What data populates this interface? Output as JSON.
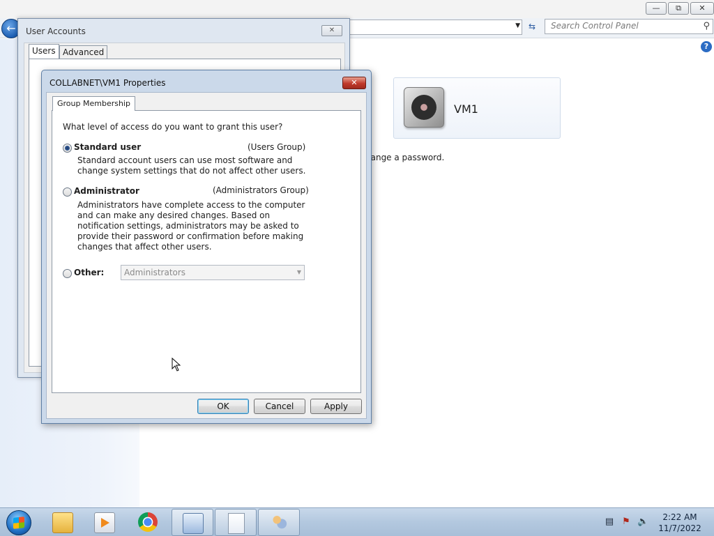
{
  "control_panel": {
    "search_placeholder": "Search Control Panel",
    "user_name": "VM1",
    "partial_text": "hange a password."
  },
  "user_accounts": {
    "title": "User Accounts",
    "tabs": [
      "Users",
      "Advanced"
    ]
  },
  "dialog": {
    "title": "COLLABNET\\VM1 Properties",
    "tab": "Group Membership",
    "question": "What level of access do you want to grant this user?",
    "options": [
      {
        "label": "Standard user",
        "group": "(Users Group)",
        "checked": true,
        "description": "Standard account users can use most software and change system settings that do not affect other users."
      },
      {
        "label": "Administrator",
        "group": "(Administrators Group)",
        "checked": false,
        "description": "Administrators have complete access to the computer and can make any desired changes. Based on notification settings, administrators may be asked to provide their password or confirmation before making changes that affect other users."
      }
    ],
    "other": {
      "label": "Other:",
      "value": "Administrators",
      "enabled": false
    },
    "buttons": {
      "ok": "OK",
      "cancel": "Cancel",
      "apply": "Apply"
    }
  },
  "taskbar": {
    "time": "2:22 AM",
    "date": "11/7/2022",
    "pinned": [
      "folder-icon",
      "media-player-icon",
      "chrome-icon",
      "control-panel-icon",
      "document-icon",
      "user-accounts-icon"
    ]
  },
  "colors": {
    "accent": "#2b6cc4",
    "close_red": "#c0392b"
  }
}
